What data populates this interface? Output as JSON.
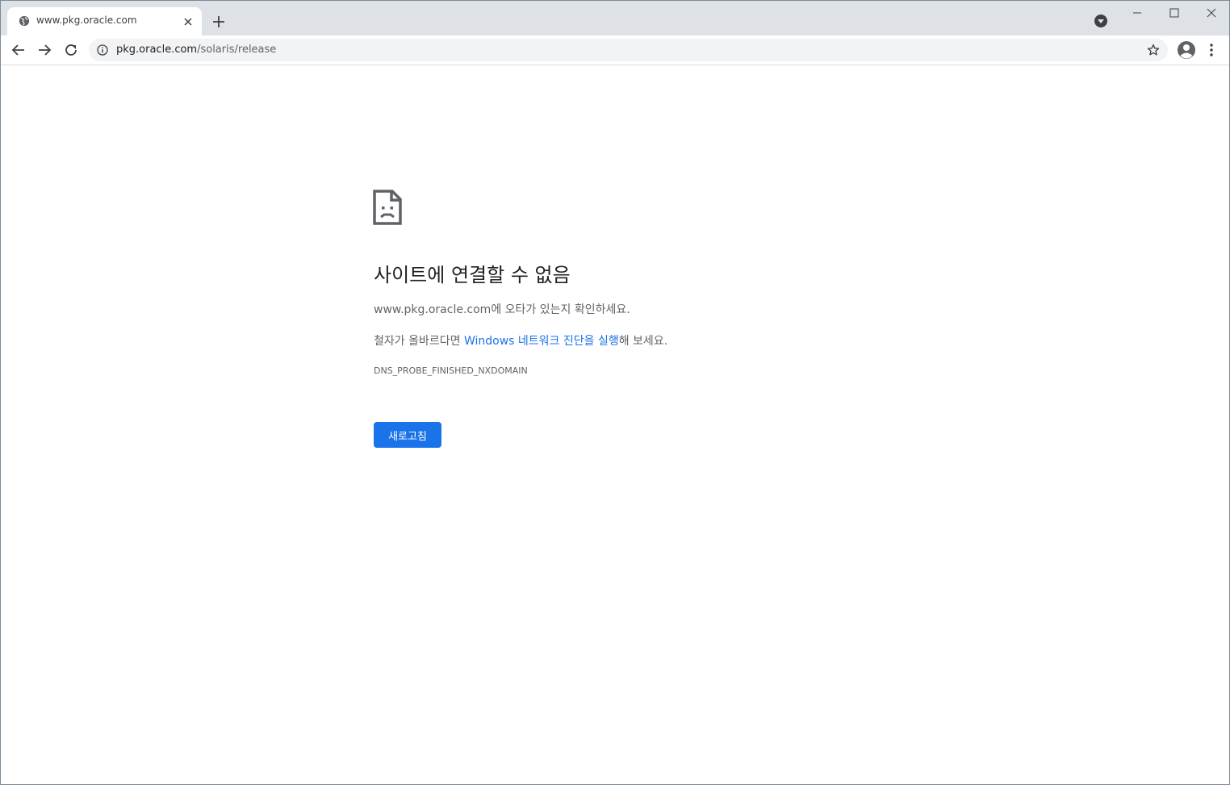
{
  "tab": {
    "title": "www.pkg.oracle.com",
    "favicon_icon": "globe-icon",
    "close_icon": "close-icon"
  },
  "tabstrip": {
    "new_tab_icon": "plus-icon",
    "tab_search_icon": "chevron-down-circle-icon"
  },
  "window_controls": {
    "minimize_icon": "minimize-icon",
    "maximize_icon": "maximize-icon",
    "close_icon": "close-icon"
  },
  "toolbar": {
    "back_icon": "arrow-left-icon",
    "forward_icon": "arrow-right-icon",
    "reload_icon": "reload-icon",
    "omnibox": {
      "info_icon": "info-icon",
      "url_host": "pkg.oracle.com",
      "url_path": "/solaris/release",
      "bookmark_icon": "star-icon"
    },
    "profile_icon": "account-circle-icon",
    "menu_icon": "kebab-menu-icon"
  },
  "error": {
    "icon": "sad-page-icon",
    "title": "사이트에 연결할 수 없음",
    "line1_host": "www.pkg.oracle.com",
    "line1_rest": "에 오타가 있는지 확인하세요.",
    "line2_prefix": "철자가 올바르다면 ",
    "line2_link": "Windows 네트워크 진단을 실행",
    "line2_suffix": "해 보세요.",
    "code": "DNS_PROBE_FINISHED_NXDOMAIN",
    "reload_label": "새로고침"
  },
  "colors": {
    "accent": "#1a73e8",
    "tabstrip_bg": "#dee1e6",
    "omnibox_bg": "#f1f3f4",
    "text_primary": "#202124",
    "text_secondary": "#5f6368"
  }
}
